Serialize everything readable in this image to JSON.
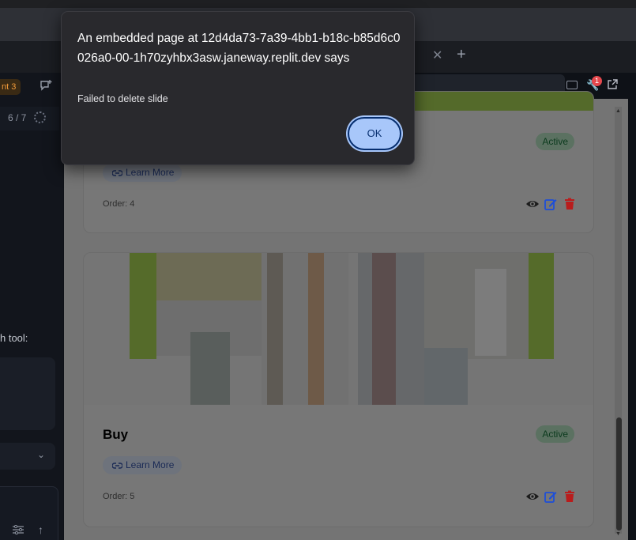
{
  "browser": {
    "notification_count": "1"
  },
  "sidebar": {
    "agent_badge": "nt 3",
    "progress": "6 / 7",
    "tool_text": "h tool:"
  },
  "slides": [
    {
      "title": "",
      "status": "Active",
      "link_label": "Learn More",
      "order": "Order: 4"
    },
    {
      "title": "Buy",
      "status": "Active",
      "link_label": "Learn More",
      "order": "Order: 5"
    }
  ],
  "dialog": {
    "title": "An embedded page at 12d4da73-7a39-4bb1-b18c-b85d6c0026a0-00-1h70zyhbx3asw.janeway.replit.dev says",
    "message": "Failed to delete slide",
    "ok_label": "OK"
  },
  "colors": {
    "ok_button": "#a8c7fa",
    "dialog_bg": "#29292d",
    "delete_icon": "#b91c1c",
    "edit_icon": "#1d4ed8",
    "agent_accent": "#f29b3a"
  },
  "icons": [
    "close-icon",
    "plus-icon",
    "new-chat-icon",
    "progress-ring-icon",
    "chevron-down-icon",
    "sliders-icon",
    "arrow-up-icon",
    "devices-icon",
    "devtools-icon",
    "external-link-icon",
    "link-icon",
    "eye-icon",
    "edit-icon",
    "trash-icon"
  ]
}
